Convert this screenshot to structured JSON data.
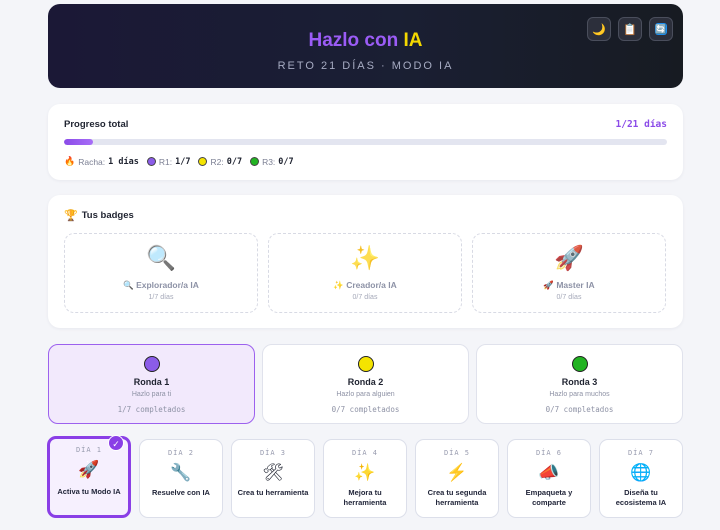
{
  "header": {
    "title_part1": "Hazlo con ",
    "title_part2": "IA",
    "subtitle": "RETO 21 DÍAS · MODO IA",
    "buttons": [
      {
        "icon": "moon-icon",
        "glyph": "🌙"
      },
      {
        "icon": "clipboard-icon",
        "glyph": "📋"
      },
      {
        "icon": "refresh-icon",
        "glyph": "🔄"
      }
    ]
  },
  "progress": {
    "label": "Progreso total",
    "count": "1/21 días",
    "fraction": 0.048,
    "streak_label": "Racha:",
    "streak_value": "1 días",
    "rounds": [
      {
        "label": "R1:",
        "value": "1/7",
        "color": "#8b5ce8"
      },
      {
        "label": "R2:",
        "value": "0/7",
        "color": "#f4e400"
      },
      {
        "label": "R3:",
        "value": "0/7",
        "color": "#22b322"
      }
    ]
  },
  "badges": {
    "title": "Tus badges",
    "items": [
      {
        "icon": "magnifier-icon",
        "big": "🔍",
        "small": "🔍",
        "name": "Explorador/a IA",
        "days": "1/7 días"
      },
      {
        "icon": "sparkles-icon",
        "big": "✨",
        "small": "✨",
        "name": "Creador/a IA",
        "days": "0/7 días"
      },
      {
        "icon": "rocket-icon",
        "big": "🚀",
        "small": "🚀",
        "name": "Master IA",
        "days": "0/7 días"
      }
    ]
  },
  "rounds": [
    {
      "name": "Ronda 1",
      "sub": "Hazlo para ti",
      "count": "1/7 completados",
      "color": "#8b5ce8",
      "active": true
    },
    {
      "name": "Ronda 2",
      "sub": "Hazlo para alguien",
      "count": "0/7 completados",
      "color": "#f4e400",
      "active": false
    },
    {
      "name": "Ronda 3",
      "sub": "Hazlo para muchos",
      "count": "0/7 completados",
      "color": "#22b322",
      "active": false
    }
  ],
  "days": [
    {
      "num": "DÍA 1",
      "icon": "rocket-icon",
      "glyph": "🚀",
      "label": "Activa tu Modo IA",
      "done": true
    },
    {
      "num": "DÍA 2",
      "icon": "wrench-icon",
      "glyph": "🔧",
      "label": "Resuelve con IA",
      "done": false
    },
    {
      "num": "DÍA 3",
      "icon": "tools-icon",
      "glyph": "🛠",
      "label": "Crea tu herramienta",
      "done": false
    },
    {
      "num": "DÍA 4",
      "icon": "sparkles-icon",
      "glyph": "✨",
      "label": "Mejora tu herramienta",
      "done": false
    },
    {
      "num": "DÍA 5",
      "icon": "lightning-icon",
      "glyph": "⚡",
      "label": "Crea tu segunda herramienta",
      "done": false
    },
    {
      "num": "DÍA 6",
      "icon": "megaphone-icon",
      "glyph": "📣",
      "label": "Empaqueta y comparte",
      "done": false
    },
    {
      "num": "DÍA 7",
      "icon": "globe-icon",
      "glyph": "🌐",
      "label": "Diseña tu ecosistema IA",
      "done": false
    }
  ]
}
